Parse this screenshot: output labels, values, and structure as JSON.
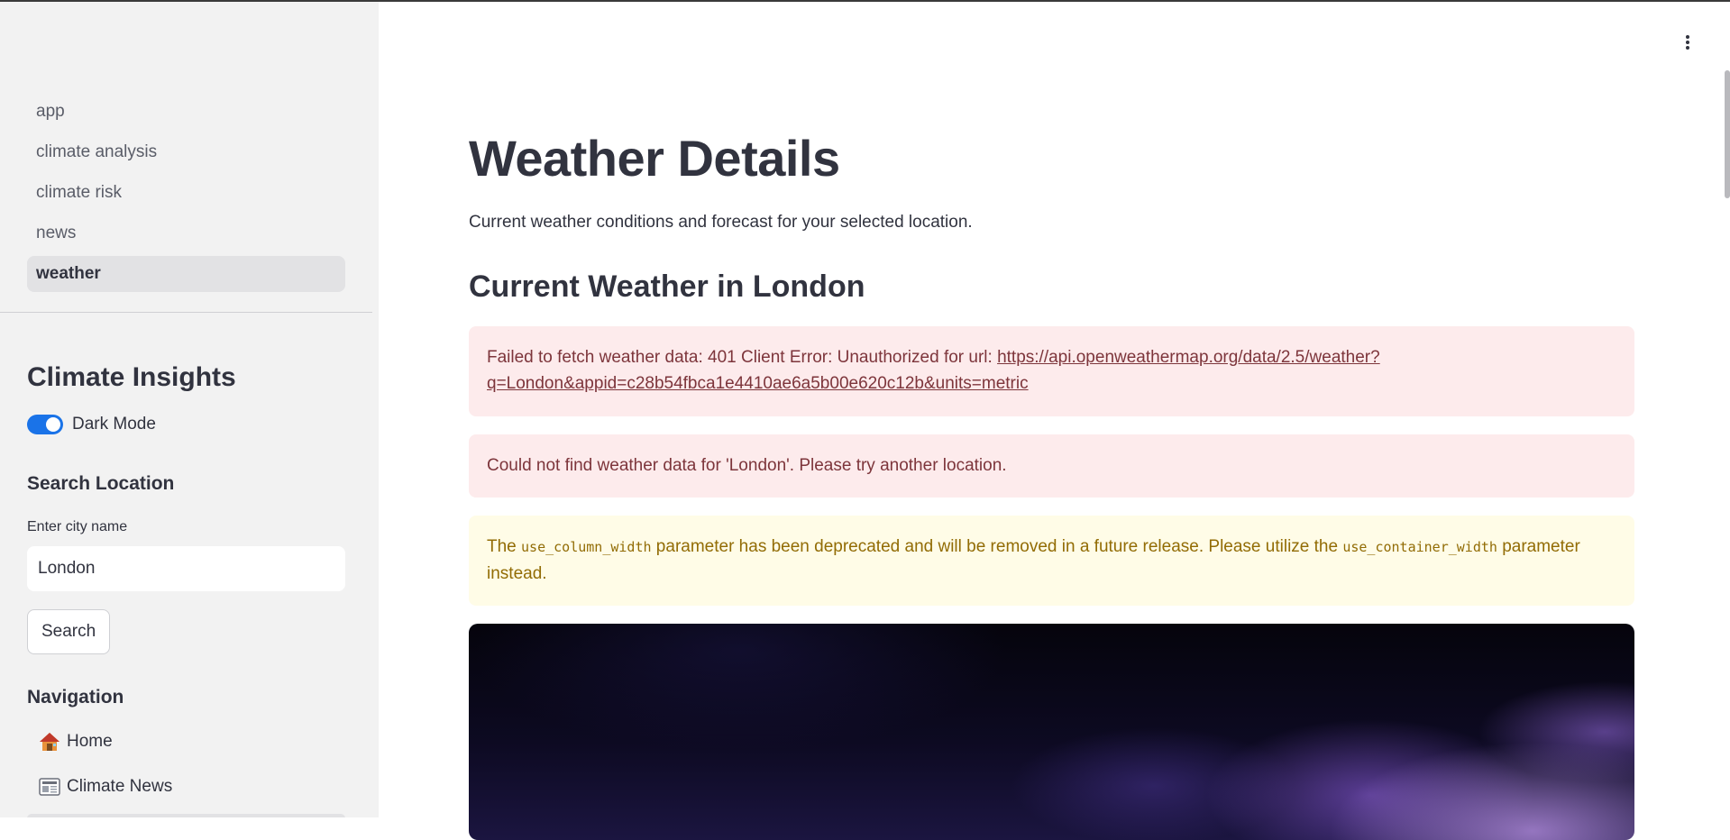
{
  "sidebar": {
    "pages": [
      {
        "label": "app",
        "active": false
      },
      {
        "label": "climate analysis",
        "active": false
      },
      {
        "label": "climate risk",
        "active": false
      },
      {
        "label": "news",
        "active": false
      },
      {
        "label": "weather",
        "active": true
      }
    ],
    "title": "Climate Insights",
    "dark_mode": {
      "label": "Dark Mode",
      "on": true
    },
    "search": {
      "heading": "Search Location",
      "field_label": "Enter city name",
      "value": "London",
      "button_label": "Search"
    },
    "navigation": {
      "heading": "Navigation",
      "items": [
        {
          "label": "Home",
          "icon": "house-icon"
        },
        {
          "label": "Climate News",
          "icon": "newspaper-icon"
        }
      ]
    }
  },
  "main": {
    "title": "Weather Details",
    "subtitle": "Current weather conditions and forecast for your selected location.",
    "current_heading": "Current Weather in London",
    "error_fetch": {
      "prefix": "Failed to fetch weather data: 401 Client Error: Unauthorized for url: ",
      "url_line1": "https://api.openweathermap.org/data/2.5/weather?",
      "url_line2": "q=London&appid=c28b54fbca1e4410ae6a5b00e620c12b&units=metric"
    },
    "error_not_found": "Could not find weather data for 'London'. Please try another location.",
    "warning": {
      "part1": "The ",
      "code1": "use_column_width",
      "part2": " parameter has been deprecated and will be removed in a future release. Please utilize the ",
      "code2": "use_container_width",
      "part3": " parameter instead."
    },
    "image_alt": "storm-clouds-image"
  },
  "colors": {
    "sidebar_bg": "#f2f2f2",
    "accent": "#1a73e8",
    "error_bg": "#fdebec",
    "error_text": "#7d353b",
    "warning_bg": "#fffce7",
    "warning_text": "#926c05"
  }
}
